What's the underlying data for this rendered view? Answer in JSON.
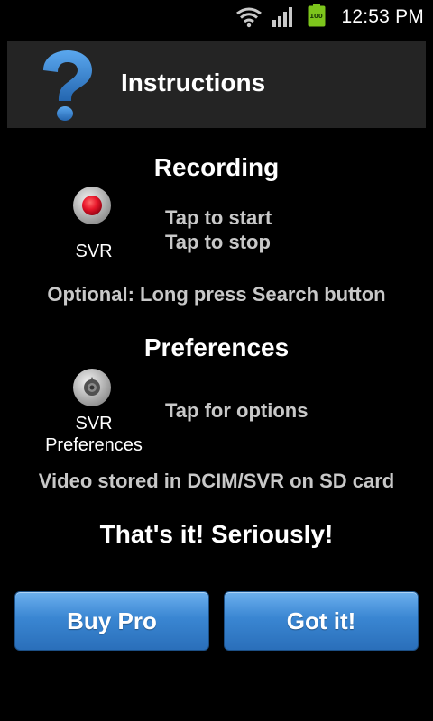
{
  "status_bar": {
    "time": "12:53 PM",
    "battery_level": "100",
    "icons": [
      "wifi-icon",
      "signal-icon",
      "battery-icon"
    ]
  },
  "title_bar": {
    "title": "Instructions",
    "icon": "question-mark-icon"
  },
  "recording": {
    "heading": "Recording",
    "icon": "record-button-icon",
    "icon_label": "SVR",
    "line1": "Tap to start",
    "line2": "Tap to stop",
    "note": "Optional: Long press Search button"
  },
  "preferences": {
    "heading": "Preferences",
    "icon": "preferences-camera-icon",
    "icon_label_line1": "SVR",
    "icon_label_line2": "Preferences",
    "line1": "Tap for options",
    "note": "Video stored in DCIM/SVR on SD card"
  },
  "tagline": "That's it! Seriously!",
  "buttons": {
    "buy_pro": "Buy Pro",
    "got_it": "Got it!"
  },
  "colors": {
    "background": "#000000",
    "title_bar": "#242424",
    "button_blue": "#3a86d2",
    "muted_text": "#c8c8c8",
    "help_icon": "#2f7fd0",
    "record_red": "#e8162a",
    "battery_green": "#7dc51c"
  }
}
